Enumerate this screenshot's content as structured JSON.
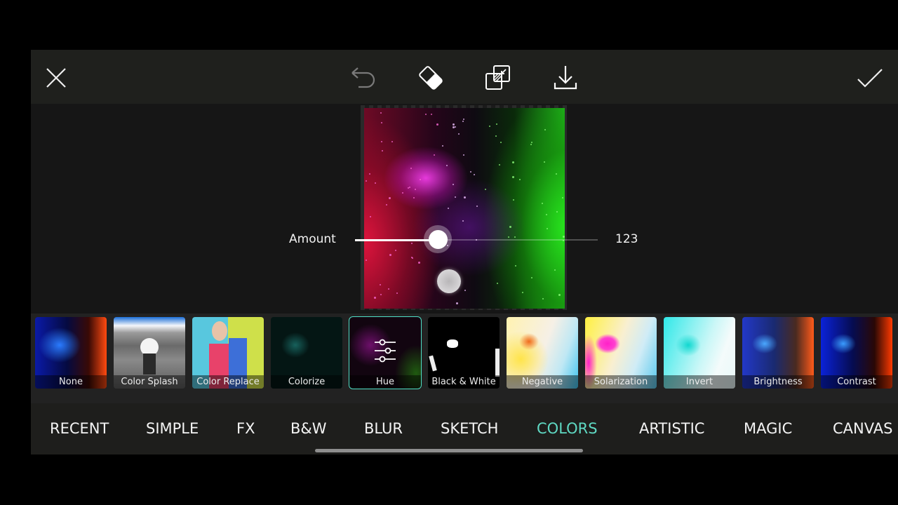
{
  "toolbar": {
    "close_icon": "close-icon",
    "undo_icon": "undo-icon",
    "eraser_icon": "eraser-icon",
    "compare_icon": "compare-layers-icon",
    "download_icon": "download-icon",
    "apply_icon": "checkmark-icon"
  },
  "slider": {
    "label": "Amount",
    "value": "123",
    "fraction": 0.34
  },
  "filters": [
    {
      "label": "None",
      "selected": false
    },
    {
      "label": "Color Splash",
      "selected": false
    },
    {
      "label": "Color Replace",
      "selected": false
    },
    {
      "label": "Colorize",
      "selected": false
    },
    {
      "label": "Hue",
      "selected": true,
      "icon": "sliders-icon"
    },
    {
      "label": "Black & White",
      "selected": false
    },
    {
      "label": "Negative",
      "selected": false
    },
    {
      "label": "Solarization",
      "selected": false
    },
    {
      "label": "Invert",
      "selected": false
    },
    {
      "label": "Brightness",
      "selected": false
    },
    {
      "label": "Contrast",
      "selected": false
    }
  ],
  "tabs": [
    {
      "label": "RECENT",
      "active": false
    },
    {
      "label": "SIMPLE",
      "active": false
    },
    {
      "label": "FX",
      "active": false
    },
    {
      "label": "B&W",
      "active": false
    },
    {
      "label": "BLUR",
      "active": false
    },
    {
      "label": "SKETCH",
      "active": false
    },
    {
      "label": "COLORS",
      "active": true
    },
    {
      "label": "ARTISTIC",
      "active": false
    },
    {
      "label": "MAGIC",
      "active": false
    },
    {
      "label": "CANVAS",
      "active": false
    }
  ],
  "colors": {
    "accent": "#5fd9c3",
    "selected_outline": "#4fe0c6",
    "toolbar_bg": "#1f201d",
    "canvas_bg": "#161616"
  }
}
